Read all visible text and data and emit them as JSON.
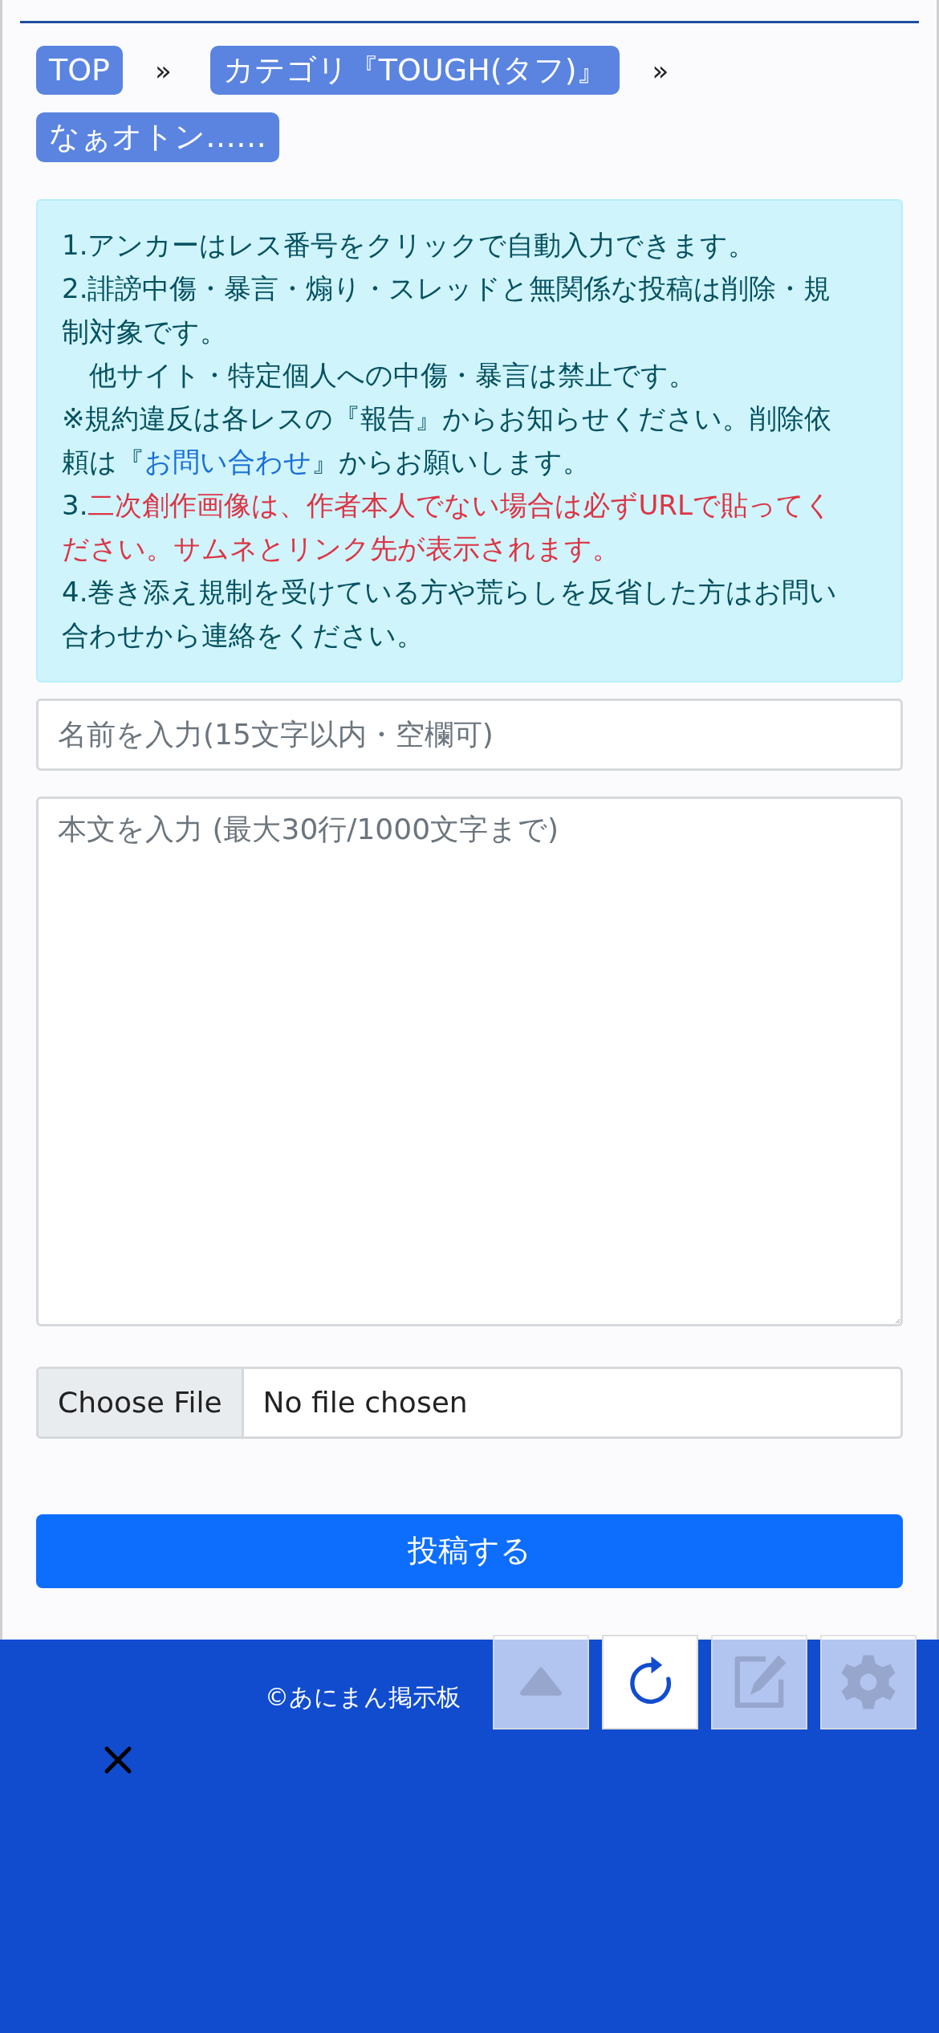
{
  "breadcrumbs": [
    {
      "kind": "crumb",
      "label": "TOP"
    },
    {
      "kind": "separator",
      "text": "»"
    },
    {
      "kind": "crumb",
      "label": "カテゴリ『TOUGH(タフ)』"
    },
    {
      "kind": "separator",
      "text": "»"
    },
    {
      "kind": "crumb",
      "label": "なぁオトン……"
    }
  ],
  "notice": [
    [
      {
        "kind": "plain",
        "text": "1.アンカーはレス番号をクリックで自動入力できます。"
      }
    ],
    [
      {
        "kind": "plain",
        "text": "2.誹謗中傷・暴言・煽り・スレッドと無関係な投稿は削除・規制対象です。"
      }
    ],
    [
      {
        "kind": "plain",
        "text": "　他サイト・特定個人への中傷・暴言は禁止です。"
      }
    ],
    [
      {
        "kind": "plain",
        "text": "※規約違反は各レスの『報告』からお知らせください。削除依頼は『"
      },
      {
        "kind": "link",
        "text": "お問い合わせ"
      },
      {
        "kind": "plain",
        "text": "』からお願いします。"
      }
    ],
    [
      {
        "kind": "plain",
        "text": "3."
      },
      {
        "kind": "warning",
        "text": "二次創作画像は、作者本人でない場合は必ずURLで貼ってください。サムネとリンク先が表示されます。"
      }
    ],
    [
      {
        "kind": "plain",
        "text": "4.巻き添え規制を受けている方や荒らしを反省した方はお問い合わせから連絡をください。"
      }
    ]
  ],
  "name_field": {
    "placeholder": "名前を入力(15文字以内・空欄可)"
  },
  "body_field": {
    "placeholder": "本文を入力 (最大30行/1000文字まで)"
  },
  "file_input": {
    "button": "Choose File",
    "status": "No file chosen"
  },
  "submit_button": "投稿する",
  "footer": {
    "copyright": "©あにまん掲示板"
  },
  "float_buttons": [
    {
      "kind": "up",
      "disabled": true
    },
    {
      "kind": "reload",
      "disabled": false
    },
    {
      "kind": "edit",
      "disabled": true
    },
    {
      "kind": "settings",
      "disabled": true
    }
  ]
}
